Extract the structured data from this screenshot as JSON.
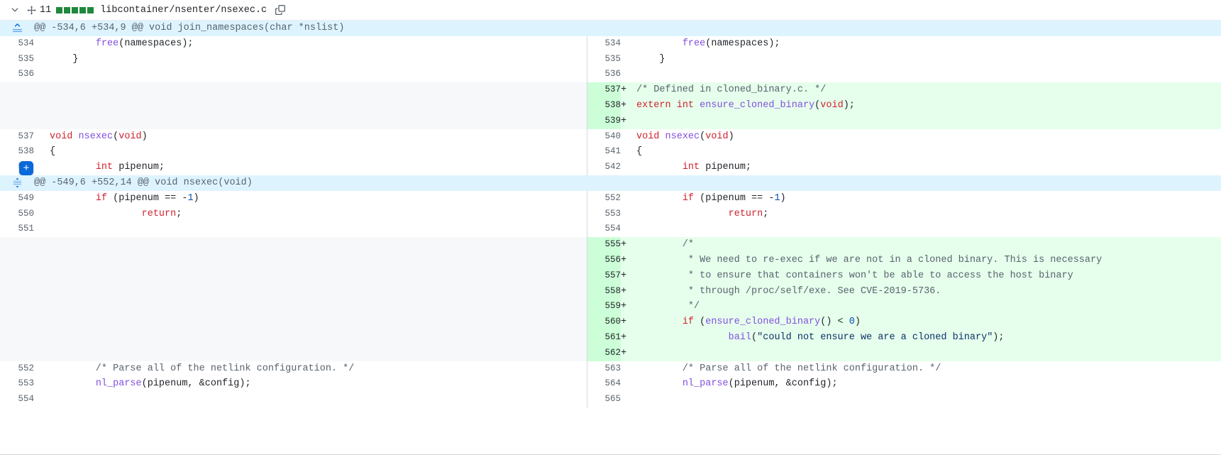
{
  "file_header": {
    "chevron_icon": "chevron-down-icon",
    "dragger_icon": "move-icon",
    "change_count": "11",
    "diffstat_blocks": [
      "added",
      "added",
      "added",
      "added",
      "added"
    ],
    "diffstat_added_color": "#1f883d",
    "filename": "libcontainer/nsenter/nsexec.c",
    "copy_icon": "copy-icon"
  },
  "colors": {
    "added_bg": "#e6ffec",
    "added_num_bg": "#ccffd8",
    "hunk_bg": "#ddf4ff",
    "blank_bg": "#f6f8fa",
    "accent": "#0969da"
  },
  "comment_button": {
    "label": "+",
    "name": "add-line-comment-button"
  },
  "hunks": [
    {
      "expand_icon": "expand-up-icon",
      "header": "@@ -534,6 +534,9 @@ void join_namespaces(char *nslist)",
      "rows": [
        {
          "type": "context",
          "left_num": "534",
          "right_num": "534",
          "tokens": [
            {
              "t": "        ",
              "c": "pn"
            },
            {
              "t": "free",
              "c": "fn"
            },
            {
              "t": "(namespaces);",
              "c": "pn"
            }
          ]
        },
        {
          "type": "context",
          "left_num": "535",
          "right_num": "535",
          "tokens": [
            {
              "t": "    }",
              "c": "pn"
            }
          ]
        },
        {
          "type": "context",
          "left_num": "536",
          "right_num": "536",
          "tokens": [
            {
              "t": "",
              "c": "pn"
            }
          ]
        },
        {
          "type": "add",
          "left_num": "",
          "right_num": "537",
          "tokens": [
            {
              "t": "/* Defined in cloned_binary.c. */",
              "c": "cm"
            }
          ]
        },
        {
          "type": "add",
          "left_num": "",
          "right_num": "538",
          "tokens": [
            {
              "t": "extern",
              "c": "k"
            },
            {
              "t": " ",
              "c": "pn"
            },
            {
              "t": "int",
              "c": "k"
            },
            {
              "t": " ",
              "c": "pn"
            },
            {
              "t": "ensure_cloned_binary",
              "c": "fn"
            },
            {
              "t": "(",
              "c": "pn"
            },
            {
              "t": "void",
              "c": "k"
            },
            {
              "t": ");",
              "c": "pn"
            }
          ]
        },
        {
          "type": "add",
          "left_num": "",
          "right_num": "539",
          "tokens": [
            {
              "t": "",
              "c": "pn"
            }
          ]
        },
        {
          "type": "context",
          "left_num": "537",
          "right_num": "540",
          "tokens": [
            {
              "t": "void",
              "c": "k"
            },
            {
              "t": " ",
              "c": "pn"
            },
            {
              "t": "nsexec",
              "c": "fn"
            },
            {
              "t": "(",
              "c": "pn"
            },
            {
              "t": "void",
              "c": "k"
            },
            {
              "t": ")",
              "c": "pn"
            }
          ]
        },
        {
          "type": "context",
          "left_num": "538",
          "right_num": "541",
          "tokens": [
            {
              "t": "{",
              "c": "pn"
            }
          ]
        },
        {
          "type": "context",
          "left_num": "539",
          "right_num": "542",
          "has_comment_button": true,
          "tokens": [
            {
              "t": "        ",
              "c": "pn"
            },
            {
              "t": "int",
              "c": "k"
            },
            {
              "t": " pipenum;",
              "c": "pn"
            }
          ]
        }
      ]
    },
    {
      "expand_icon": "expand-up-down-icon",
      "header": "@@ -549,6 +552,14 @@ void nsexec(void)",
      "rows": [
        {
          "type": "context",
          "left_num": "549",
          "right_num": "552",
          "tokens": [
            {
              "t": "        ",
              "c": "pn"
            },
            {
              "t": "if",
              "c": "k"
            },
            {
              "t": " (pipenum == -",
              "c": "pn"
            },
            {
              "t": "1",
              "c": "nu"
            },
            {
              "t": ")",
              "c": "pn"
            }
          ]
        },
        {
          "type": "context",
          "left_num": "550",
          "right_num": "553",
          "tokens": [
            {
              "t": "                ",
              "c": "pn"
            },
            {
              "t": "return",
              "c": "k"
            },
            {
              "t": ";",
              "c": "pn"
            }
          ]
        },
        {
          "type": "context",
          "left_num": "551",
          "right_num": "554",
          "tokens": [
            {
              "t": "",
              "c": "pn"
            }
          ]
        },
        {
          "type": "add",
          "left_num": "",
          "right_num": "555",
          "tokens": [
            {
              "t": "        /*",
              "c": "cm"
            }
          ]
        },
        {
          "type": "add",
          "left_num": "",
          "right_num": "556",
          "tokens": [
            {
              "t": "         * We need to re-exec if we are not in a cloned binary. This is necessary",
              "c": "cm"
            }
          ]
        },
        {
          "type": "add",
          "left_num": "",
          "right_num": "557",
          "tokens": [
            {
              "t": "         * to ensure that containers won't be able to access the host binary",
              "c": "cm"
            }
          ]
        },
        {
          "type": "add",
          "left_num": "",
          "right_num": "558",
          "tokens": [
            {
              "t": "         * through /proc/self/exe. See CVE-2019-5736.",
              "c": "cm"
            }
          ]
        },
        {
          "type": "add",
          "left_num": "",
          "right_num": "559",
          "tokens": [
            {
              "t": "         */",
              "c": "cm"
            }
          ]
        },
        {
          "type": "add",
          "left_num": "",
          "right_num": "560",
          "tokens": [
            {
              "t": "        ",
              "c": "pn"
            },
            {
              "t": "if",
              "c": "k"
            },
            {
              "t": " (",
              "c": "pn"
            },
            {
              "t": "ensure_cloned_binary",
              "c": "fn"
            },
            {
              "t": "() < ",
              "c": "pn"
            },
            {
              "t": "0",
              "c": "nu"
            },
            {
              "t": ")",
              "c": "pn"
            }
          ]
        },
        {
          "type": "add",
          "left_num": "",
          "right_num": "561",
          "tokens": [
            {
              "t": "                ",
              "c": "pn"
            },
            {
              "t": "bail",
              "c": "fn"
            },
            {
              "t": "(",
              "c": "pn"
            },
            {
              "t": "\"could not ensure we are a cloned binary\"",
              "c": "st"
            },
            {
              "t": ");",
              "c": "pn"
            }
          ]
        },
        {
          "type": "add",
          "left_num": "",
          "right_num": "562",
          "tokens": [
            {
              "t": "",
              "c": "pn"
            }
          ]
        },
        {
          "type": "context",
          "left_num": "552",
          "right_num": "563",
          "tokens": [
            {
              "t": "        /* Parse all of the netlink configuration. */",
              "c": "cm"
            }
          ]
        },
        {
          "type": "context",
          "left_num": "553",
          "right_num": "564",
          "tokens": [
            {
              "t": "        ",
              "c": "pn"
            },
            {
              "t": "nl_parse",
              "c": "fn"
            },
            {
              "t": "(pipenum, &config);",
              "c": "pn"
            }
          ]
        },
        {
          "type": "context",
          "left_num": "554",
          "right_num": "565",
          "tokens": [
            {
              "t": "",
              "c": "pn"
            }
          ]
        }
      ]
    }
  ]
}
